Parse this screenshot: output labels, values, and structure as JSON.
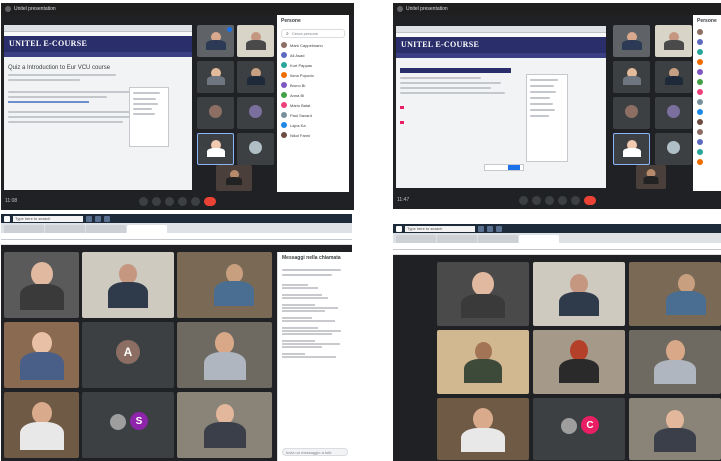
{
  "top_left": {
    "meeting_title": "Unitel presentation",
    "course_banner": "UNITEL E-COURSE",
    "course_heading": "Quiz a Introduction to Eur VCU course",
    "panel_title": "Persone",
    "panel_search": "Cerca persone",
    "time": "11:08",
    "participants": [
      "Mark Cappelmann",
      "Ali Asad",
      "Kurt Pappas",
      "Ilona Popovic",
      "Bruno Bi",
      "Anna Bi",
      "Mario Balat",
      "Paul Savard",
      "Lajos Ka",
      "Nikol Fanni"
    ]
  },
  "top_right": {
    "meeting_title": "Unitel presentation",
    "course_banner": "UNITEL E-COURSE",
    "time": "11:47",
    "panel_title": "Persone"
  },
  "bottom_left": {
    "taskbar_search": "Type here to search",
    "chat_title": "Messaggi nella chiamata",
    "chat_input": "Invia un messaggio a tutti",
    "avatar_letters": [
      "A",
      "S"
    ]
  },
  "bottom_right": {
    "taskbar_search": "Type here to search",
    "avatar_letters": [
      "C"
    ]
  },
  "colors": {
    "meet_bg": "#202124",
    "tile_bg": "#3c4043",
    "course_banner": "#2a2e6b",
    "end_call": "#ea4335",
    "avatar_a": "#8d6e63",
    "avatar_s": "#8e24aa",
    "avatar_c": "#e91e63"
  }
}
